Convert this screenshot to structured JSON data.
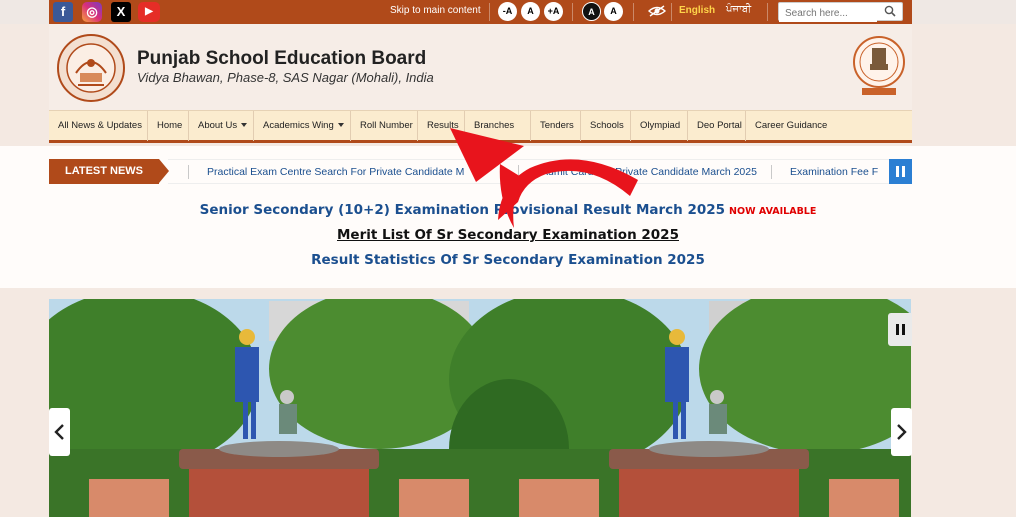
{
  "topbar": {
    "social": [
      {
        "name": "facebook-icon",
        "glyph": "f"
      },
      {
        "name": "instagram-icon",
        "glyph": "◎"
      },
      {
        "name": "x-icon",
        "glyph": "X"
      },
      {
        "name": "youtube-icon",
        "glyph": "▶"
      }
    ],
    "skip_link": "Skip to main content",
    "font_sizes": [
      "-A",
      "A",
      "+A"
    ],
    "contrast": [
      "A",
      "A"
    ],
    "lang_english": "English",
    "lang_punjabi": "ਪੰਜਾਬੀ",
    "search_placeholder": "Search here..."
  },
  "header": {
    "title": "Punjab School Education Board",
    "subtitle": "Vidya Bhawan, Phase-8, SAS Nagar (Mohali), India"
  },
  "nav": {
    "items": [
      {
        "label": "All News & Updates"
      },
      {
        "label": "Home"
      },
      {
        "label": "About Us"
      },
      {
        "label": "Academics Wing"
      },
      {
        "label": "Roll Number"
      },
      {
        "label": "Results"
      },
      {
        "label": "Branches"
      },
      {
        "label": "Tenders"
      },
      {
        "label": "Schools"
      },
      {
        "label": "Olympiad"
      },
      {
        "label": "Deo Portal"
      },
      {
        "label": "Career Guidance"
      }
    ]
  },
  "news": {
    "label": "LATEST NEWS",
    "items": [
      "Practical Exam Centre Search For Private Candidate M",
      "Admit Card For Private Candidate March 2025",
      "Examination Fee F"
    ]
  },
  "announcements": {
    "line1": "Senior Secondary (10+2) Examination Provisional Result March 2025",
    "line1_badge": "NOW AVAILABLE",
    "line2": "Merit List Of Sr Secondary Examination 2025",
    "line3": "Result Statistics Of Sr Secondary Examination 2025"
  },
  "colors": {
    "brand": "#b04a1a",
    "link": "#1b4f8f",
    "badge": "#e00000",
    "arrow_overlay": "#e8141c"
  }
}
